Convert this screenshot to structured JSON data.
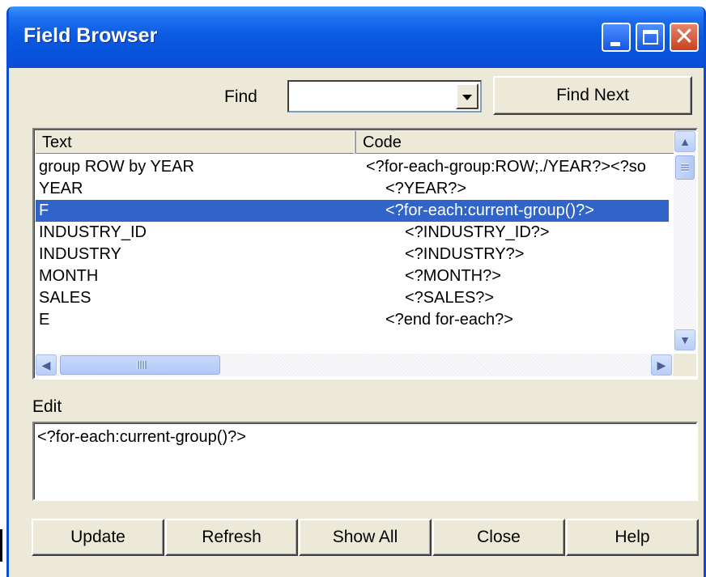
{
  "window": {
    "title": "Field Browser"
  },
  "find": {
    "label": "Find",
    "value": "",
    "find_next_label": "Find Next"
  },
  "list": {
    "columns": [
      "Text",
      "Code"
    ],
    "rows": [
      {
        "text": "group ROW by YEAR",
        "code": "<?for-each-group:ROW;./YEAR?><?so",
        "indent": 0
      },
      {
        "text": "YEAR",
        "code": "<?YEAR?>",
        "indent": 1
      },
      {
        "text": "F",
        "code": "<?for-each:current-group()?>",
        "indent": 1,
        "selected": true
      },
      {
        "text": "INDUSTRY_ID",
        "code": "<?INDUSTRY_ID?>",
        "indent": 2
      },
      {
        "text": "INDUSTRY",
        "code": "<?INDUSTRY?>",
        "indent": 2
      },
      {
        "text": "MONTH",
        "code": "<?MONTH?>",
        "indent": 2
      },
      {
        "text": "SALES",
        "code": "<?SALES?>",
        "indent": 2
      },
      {
        "text": " E",
        "code": "<?end for-each?>",
        "indent": 1
      }
    ],
    "hscroll_thumb_glyph": "III"
  },
  "edit": {
    "label": "Edit",
    "value": "<?for-each:current-group()?>"
  },
  "buttons": {
    "update": "Update",
    "refresh": "Refresh",
    "show_all": "Show All",
    "close": "Close",
    "help": "Help"
  },
  "icons": {
    "minimize": "minimize-icon",
    "maximize": "maximize-icon",
    "close": "close-icon"
  },
  "colors": {
    "titlebar": "#0a5ae0",
    "selection": "#3164c9",
    "dialog_bg": "#ece9d8"
  }
}
